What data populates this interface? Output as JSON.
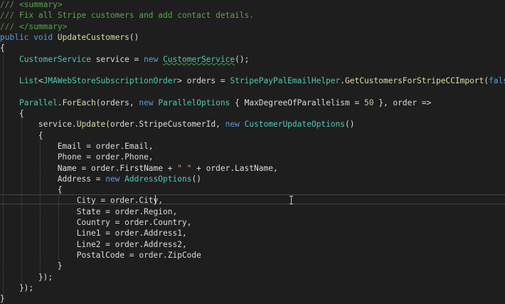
{
  "editor": {
    "lines": [
      [
        {
          "t": "/// ",
          "c": "d"
        },
        {
          "t": "<summary>",
          "c": "c"
        }
      ],
      [
        {
          "t": "/// ",
          "c": "d"
        },
        {
          "t": "Fix all Stripe customers and add contact details.",
          "c": "c"
        }
      ],
      [
        {
          "t": "/// ",
          "c": "d"
        },
        {
          "t": "</summary>",
          "c": "c"
        }
      ],
      [
        {
          "t": "public",
          "c": "k"
        },
        {
          "t": " "
        },
        {
          "t": "void",
          "c": "k"
        },
        {
          "t": " "
        },
        {
          "t": "UpdateCustomers",
          "c": "m"
        },
        {
          "t": "()"
        }
      ],
      [
        {
          "t": "{"
        }
      ],
      [
        {
          "t": "    "
        },
        {
          "t": "CustomerService",
          "c": "t"
        },
        {
          "t": " service = "
        },
        {
          "t": "new",
          "c": "k"
        },
        {
          "t": " "
        },
        {
          "t": "CustomerService",
          "c": "t",
          "u": true
        },
        {
          "t": "();"
        }
      ],
      [
        {
          "t": ""
        }
      ],
      [
        {
          "t": "    "
        },
        {
          "t": "List",
          "c": "t"
        },
        {
          "t": "<"
        },
        {
          "t": "JMAWebStoreSubscriptionOrder",
          "c": "t"
        },
        {
          "t": "> orders = "
        },
        {
          "t": "StripePayPalEmailHelper",
          "c": "t"
        },
        {
          "t": "."
        },
        {
          "t": "GetCustomersForStripeCCImport",
          "c": "m"
        },
        {
          "t": "("
        },
        {
          "t": "false",
          "c": "k"
        },
        {
          "t": ");"
        }
      ],
      [
        {
          "t": ""
        }
      ],
      [
        {
          "t": "    "
        },
        {
          "t": "Parallel",
          "c": "t"
        },
        {
          "t": "."
        },
        {
          "t": "ForEach",
          "c": "m"
        },
        {
          "t": "(orders, "
        },
        {
          "t": "new",
          "c": "k"
        },
        {
          "t": " "
        },
        {
          "t": "ParallelOptions",
          "c": "t"
        },
        {
          "t": " { MaxDegreeOfParallelism = "
        },
        {
          "t": "50",
          "c": "n"
        },
        {
          "t": " }, order =>"
        }
      ],
      [
        {
          "t": "    {"
        }
      ],
      [
        {
          "t": "        service."
        },
        {
          "t": "Update",
          "c": "m"
        },
        {
          "t": "(order.StripeCustomerId, "
        },
        {
          "t": "new",
          "c": "k"
        },
        {
          "t": " "
        },
        {
          "t": "CustomerUpdateOptions",
          "c": "t"
        },
        {
          "t": "()"
        }
      ],
      [
        {
          "t": "        {"
        }
      ],
      [
        {
          "t": "            Email = order.Email,"
        }
      ],
      [
        {
          "t": "            Phone = order.Phone,"
        }
      ],
      [
        {
          "t": "            Name = order.FirstName + "
        },
        {
          "t": "\" \"",
          "c": "s"
        },
        {
          "t": " + order.LastName,"
        }
      ],
      [
        {
          "t": "            Address = "
        },
        {
          "t": "new",
          "c": "k"
        },
        {
          "t": " "
        },
        {
          "t": "AddressOptions",
          "c": "t"
        },
        {
          "t": "()"
        }
      ],
      [
        {
          "t": "            {"
        }
      ],
      [
        {
          "t": "                City = order.City,"
        }
      ],
      [
        {
          "t": "                State = order.Region,"
        }
      ],
      [
        {
          "t": "                Country = order.Country,"
        }
      ],
      [
        {
          "t": "                Line1 = order.Address1,"
        }
      ],
      [
        {
          "t": "                Line2 = order.Address2,"
        }
      ],
      [
        {
          "t": "                PostalCode = order.ZipCode"
        }
      ],
      [
        {
          "t": "            }"
        }
      ],
      [
        {
          "t": "        });"
        }
      ],
      [
        {
          "t": "    });"
        }
      ],
      [
        {
          "t": "}"
        }
      ]
    ],
    "colors": {
      "background": "#1e1e1e",
      "plain": "#dcdcdc",
      "comment": "#57a64a",
      "doc_prefix": "#608b4e",
      "keyword": "#569cd6",
      "type": "#4ec9b0",
      "method": "#dcdcaa",
      "string": "#d69d85",
      "number": "#b5cea8"
    },
    "icons": [
      "i-beam-cursor-icon"
    ]
  }
}
